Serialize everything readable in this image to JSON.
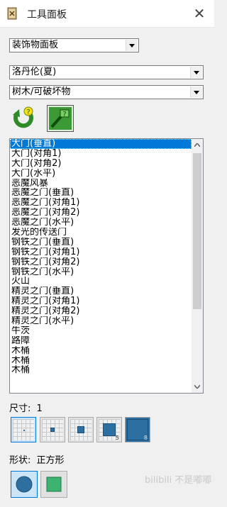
{
  "window": {
    "title": "工具面板",
    "app_icon": "scroll-icon",
    "close_symbol": "✕"
  },
  "dropdowns": {
    "panel": "装饰物面板",
    "map": "洛丹伦(夏)",
    "category": "树木/可破坏物"
  },
  "toolbar": {
    "refresh_icon": "green-refresh-arrow-icon",
    "map_icon": "green-map-icon"
  },
  "list": {
    "selected_index": 0,
    "items": [
      "大门(垂直)",
      "大门(对角1)",
      "大门(对角2)",
      "大门(水平)",
      "恶魔风暴",
      "恶魔之门(垂直)",
      "恶魔之门(对角1)",
      "恶魔之门(对角2)",
      "恶魔之门(水平)",
      "发光的传送门",
      "钢铁之门(垂直)",
      "钢铁之门(对角1)",
      "钢铁之门(对角2)",
      "钢铁之门(水平)",
      "火山",
      "精灵之门(垂直)",
      "精灵之门(对角1)",
      "精灵之门(对角2)",
      "精灵之门(水平)",
      "牛茨",
      "路障",
      "木桶",
      "木桶",
      "木桶"
    ]
  },
  "size": {
    "label": "尺寸:",
    "value": "1",
    "buttons": [
      "1",
      "2",
      "3",
      "5",
      "8"
    ],
    "selected": "1",
    "num_labels": [
      "5",
      "8"
    ]
  },
  "shape": {
    "label": "形状:",
    "value": "正方形",
    "options": [
      "圆形",
      "正方形"
    ],
    "selected": "正方形"
  },
  "watermark": "bilibili 不是嘟嘟"
}
